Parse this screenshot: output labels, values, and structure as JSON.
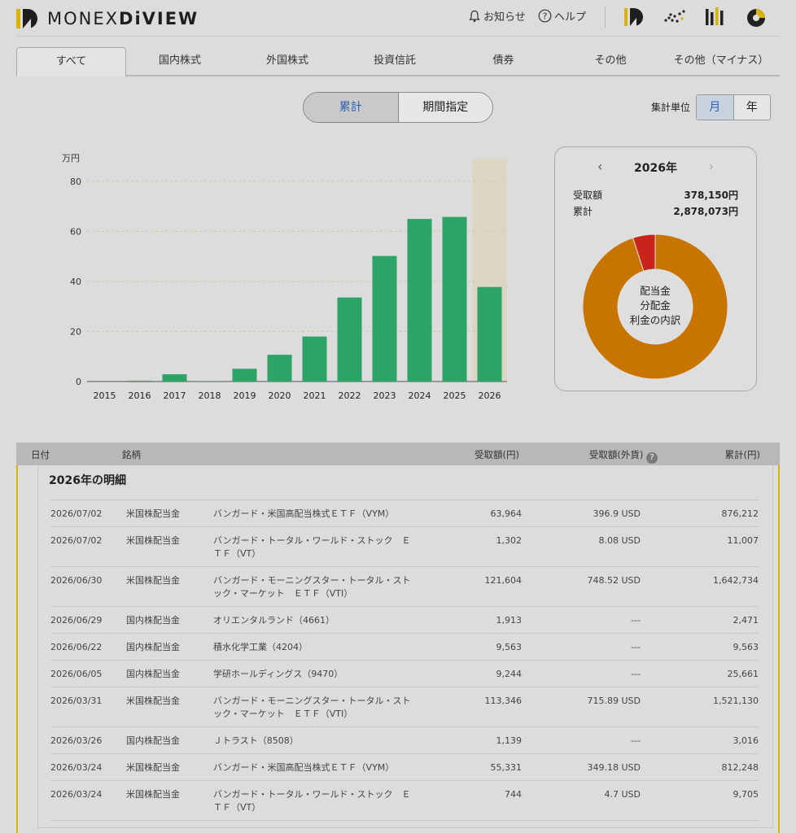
{
  "header": {
    "brand_left": "MONEX",
    "brand_right": "DiVIEW",
    "notice_label": "お知らせ",
    "help_label": "ヘルプ",
    "icons": [
      "diview-logo-icon",
      "dots-scatter-icon",
      "bars-icon",
      "pie-icon"
    ],
    "colors": {
      "accent": "#d8b400"
    }
  },
  "tabs": [
    {
      "label": "すべて",
      "active": true
    },
    {
      "label": "国内株式"
    },
    {
      "label": "外国株式"
    },
    {
      "label": "投資信託"
    },
    {
      "label": "債券"
    },
    {
      "label": "その他"
    },
    {
      "label": "その他（マイナス）"
    }
  ],
  "view_toggle": {
    "cumulative": "累計",
    "period": "期間指定",
    "selected": "累計"
  },
  "unit": {
    "label": "集計単位",
    "month": "月",
    "year": "年",
    "selected": "月"
  },
  "chart_data": {
    "type": "bar",
    "ylabel": "万円",
    "ylim": [
      0,
      90
    ],
    "yticks": [
      0,
      20,
      40,
      60,
      80
    ],
    "categories": [
      "2015",
      "2016",
      "2017",
      "2018",
      "2019",
      "2020",
      "2021",
      "2022",
      "2023",
      "2024",
      "2025",
      "2026"
    ],
    "values": [
      0,
      0.3,
      2.9,
      0.1,
      5.1,
      10.7,
      18.0,
      33.6,
      50.2,
      65.0,
      65.8,
      37.8
    ],
    "highlight_category": "2026",
    "colors": {
      "bar": "#2ea367",
      "highlight_bg": "#ddd6c4",
      "grid": "#d4cc9a"
    }
  },
  "summary_card": {
    "year": "2026年",
    "received_label": "受取額",
    "received_value": "378,150円",
    "cumulative_label": "累計",
    "cumulative_value": "2,878,073円",
    "donut_center": [
      "配当金",
      "分配金",
      "利金の内訳"
    ],
    "donut": [
      {
        "name": "米国株配当金",
        "value": 0.95,
        "color": "#c87400"
      },
      {
        "name": "国内株配当金",
        "value": 0.05,
        "color": "#c8241a"
      }
    ]
  },
  "table": {
    "headers": {
      "date": "日付",
      "name": "銘柄",
      "jpy": "受取額(円)",
      "fx": "受取額(外貨)",
      "cum": "累計(円)"
    },
    "detail_title": "2026年の明細",
    "rows": [
      {
        "date": "2026/07/02",
        "type": "米国株配当金",
        "name": "バンガード・米国高配当株式ＥＴＦ（VYM）",
        "jpy": "63,964",
        "fx": "396.9 USD",
        "cum": "876,212"
      },
      {
        "date": "2026/07/02",
        "type": "米国株配当金",
        "name": "バンガード・トータル・ワールド・ストック　ＥＴＦ（VT）",
        "jpy": "1,302",
        "fx": "8.08 USD",
        "cum": "11,007"
      },
      {
        "date": "2026/06/30",
        "type": "米国株配当金",
        "name": "バンガード・モーニングスター・トータル・ストック・マーケット　ＥＴＦ（VTI）",
        "jpy": "121,604",
        "fx": "748.52 USD",
        "cum": "1,642,734"
      },
      {
        "date": "2026/06/29",
        "type": "国内株配当金",
        "name": "オリエンタルランド（4661）",
        "jpy": "1,913",
        "fx": "---",
        "cum": "2,471"
      },
      {
        "date": "2026/06/22",
        "type": "国内株配当金",
        "name": "積水化学工業（4204）",
        "jpy": "9,563",
        "fx": "---",
        "cum": "9,563"
      },
      {
        "date": "2026/06/05",
        "type": "国内株配当金",
        "name": "学研ホールディングス（9470）",
        "jpy": "9,244",
        "fx": "---",
        "cum": "25,661"
      },
      {
        "date": "2026/03/31",
        "type": "米国株配当金",
        "name": "バンガード・モーニングスター・トータル・ストック・マーケット　ＥＴＦ（VTI）",
        "jpy": "113,346",
        "fx": "715.89 USD",
        "cum": "1,521,130"
      },
      {
        "date": "2026/03/26",
        "type": "国内株配当金",
        "name": "Ｊトラスト（8508）",
        "jpy": "1,139",
        "fx": "---",
        "cum": "3,016"
      },
      {
        "date": "2026/03/24",
        "type": "米国株配当金",
        "name": "バンガード・米国高配当株式ＥＴＦ（VYM）",
        "jpy": "55,331",
        "fx": "349.18 USD",
        "cum": "812,248"
      },
      {
        "date": "2026/03/24",
        "type": "米国株配当金",
        "name": "バンガード・トータル・ワールド・ストック　ＥＴＦ（VT）",
        "jpy": "744",
        "fx": "4.7 USD",
        "cum": "9,705"
      }
    ]
  }
}
